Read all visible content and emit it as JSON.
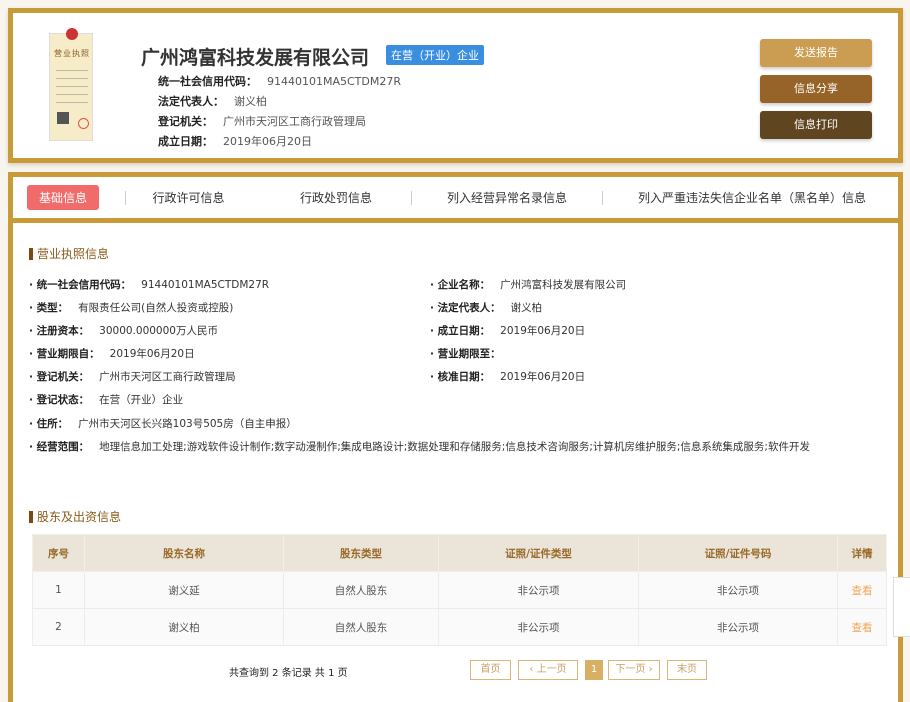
{
  "company": {
    "name": "广州鸿富科技发展有限公司",
    "status": "在营（开业）企业",
    "license_title": "营业执照",
    "fields": [
      {
        "label": "统一社会信用代码：",
        "value": "91440101MA5CTDM27R"
      },
      {
        "label": "法定代表人：",
        "value": "谢义柏"
      },
      {
        "label": "登记机关：",
        "value": "广州市天河区工商行政管理局"
      },
      {
        "label": "成立日期：",
        "value": "2019年06月20日"
      }
    ]
  },
  "actions": [
    {
      "label": "发送报告",
      "color": "#cb9d52"
    },
    {
      "label": "信息分享",
      "color": "#966428"
    },
    {
      "label": "信息打印",
      "color": "#5f4620"
    }
  ],
  "tabs": [
    "基础信息",
    "行政许可信息",
    "行政处罚信息",
    "列入经营异常名录信息",
    "列入严重违法失信企业名单（黑名单）信息"
  ],
  "license_section": {
    "title": "营业执照信息",
    "left": [
      {
        "label": "统一社会信用代码：",
        "value": "91440101MA5CTDM27R"
      },
      {
        "label": "类型：",
        "value": "有限责任公司(自然人投资或控股)"
      },
      {
        "label": "注册资本：",
        "value": "30000.000000万人民币"
      },
      {
        "label": "营业期限自：",
        "value": "2019年06月20日"
      },
      {
        "label": "登记机关：",
        "value": "广州市天河区工商行政管理局"
      },
      {
        "label": "登记状态：",
        "value": "在营（开业）企业"
      }
    ],
    "right": [
      {
        "label": "企业名称：",
        "value": "广州鸿富科技发展有限公司"
      },
      {
        "label": "法定代表人：",
        "value": "谢义柏"
      },
      {
        "label": "成立日期：",
        "value": "2019年06月20日"
      },
      {
        "label": "营业期限至：",
        "value": ""
      },
      {
        "label": "核准日期：",
        "value": "2019年06月20日"
      }
    ],
    "address": {
      "label": "住所：",
      "value": "广州市天河区长兴路103号505房（自主申报）"
    },
    "scope": {
      "label": "经营范围：",
      "value": "地理信息加工处理;游戏软件设计制作;数字动漫制作;集成电路设计;数据处理和存储服务;信息技术咨询服务;计算机房维护服务;信息系统集成服务;软件开发"
    }
  },
  "shareholders": {
    "title": "股东及出资信息",
    "headers": [
      "序号",
      "股东名称",
      "股东类型",
      "证照/证件类型",
      "证照/证件号码",
      "详情"
    ],
    "rows": [
      [
        "1",
        "谢义延",
        "自然人股东",
        "非公示项",
        "非公示项",
        "查看"
      ],
      [
        "2",
        "谢义柏",
        "自然人股东",
        "非公示项",
        "非公示项",
        "查看"
      ]
    ]
  },
  "pagination": {
    "summary": "共查询到 2 条记录 共 1 页",
    "first": "首页",
    "prev": "‹ 上一页",
    "current": "1",
    "next": "下一页 ›",
    "last": "末页"
  }
}
